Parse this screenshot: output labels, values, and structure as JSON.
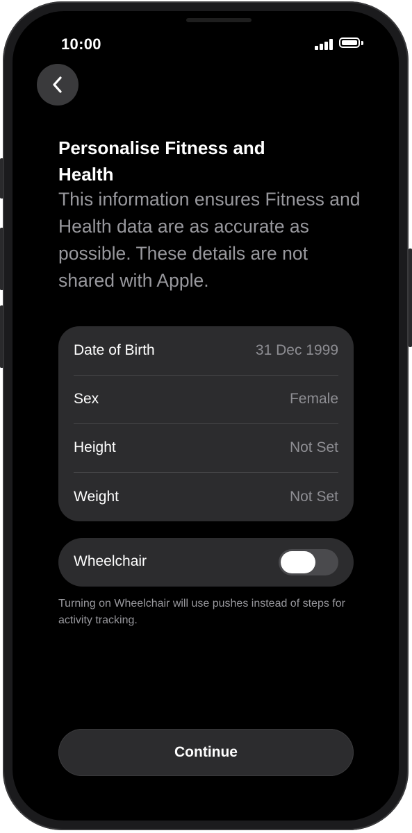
{
  "status_bar": {
    "time": "10:00",
    "signal_icon": "cellular-signal-icon",
    "battery_icon": "battery-full-icon"
  },
  "nav": {
    "back_icon": "chevron-left-icon"
  },
  "header": {
    "title": "Personalise Fitness and Health",
    "description": "This information ensures Fitness and Health data are as accurate as possible. These details are not shared with Apple."
  },
  "details": [
    {
      "label": "Date of Birth",
      "value": "31 Dec 1999"
    },
    {
      "label": "Sex",
      "value": "Female"
    },
    {
      "label": "Height",
      "value": "Not Set"
    },
    {
      "label": "Weight",
      "value": "Not Set"
    }
  ],
  "wheelchair": {
    "label": "Wheelchair",
    "enabled": false,
    "footnote": "Turning on Wheelchair will use pushes instead of steps for activity tracking."
  },
  "continue_label": "Continue",
  "colors": {
    "background": "#000000",
    "card": "#2c2c2e",
    "primary_text": "#ffffff",
    "secondary_text": "#98989d"
  }
}
